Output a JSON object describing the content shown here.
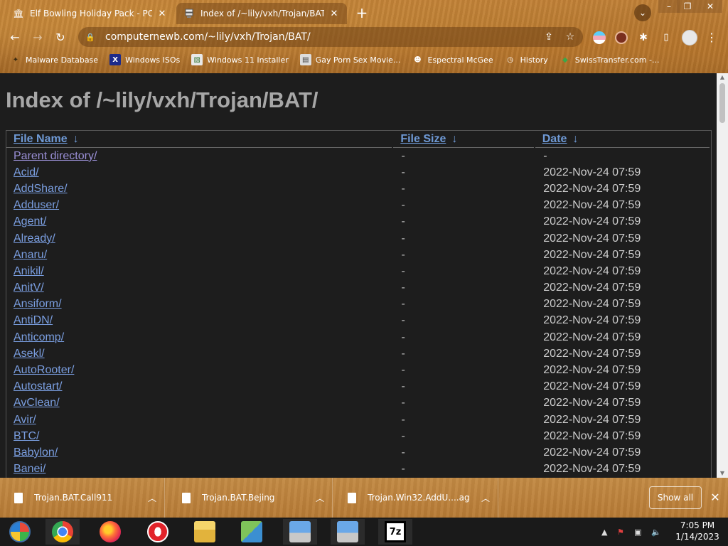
{
  "browser": {
    "tabs": [
      {
        "title": "Elf Bowling Holiday Pack - PC gam",
        "favicon": "building-icon",
        "active": false
      },
      {
        "title": "Index of /~lily/vxh/Trojan/BAT/",
        "favicon": "server-icon",
        "active": true
      }
    ],
    "url": "computernewb.com/~lily/vxh/Trojan/BAT/",
    "bookmarks": [
      {
        "label": "Malware Database",
        "icon": "malware-icon"
      },
      {
        "label": "Windows ISOs",
        "icon": "x-icon"
      },
      {
        "label": "Windows 11 Installer",
        "icon": "image-icon"
      },
      {
        "label": "Gay Porn Sex Movie...",
        "icon": "server-icon"
      },
      {
        "label": "Espectral McGee",
        "icon": "ghost-icon"
      },
      {
        "label": "History",
        "icon": "history-icon"
      },
      {
        "label": "SwissTransfer.com -...",
        "icon": "swiss-icon"
      }
    ]
  },
  "page": {
    "heading": "Index of /~lily/vxh/Trojan/BAT/",
    "columns": {
      "name": "File Name",
      "size": "File Size",
      "date": "Date",
      "sort_arrow": "↓"
    },
    "rows": [
      {
        "name": "Parent directory/",
        "size": "-",
        "date": "-"
      },
      {
        "name": "Acid/",
        "size": "-",
        "date": "2022-Nov-24 07:59"
      },
      {
        "name": "AddShare/",
        "size": "-",
        "date": "2022-Nov-24 07:59"
      },
      {
        "name": "Adduser/",
        "size": "-",
        "date": "2022-Nov-24 07:59"
      },
      {
        "name": "Agent/",
        "size": "-",
        "date": "2022-Nov-24 07:59"
      },
      {
        "name": "Already/",
        "size": "-",
        "date": "2022-Nov-24 07:59"
      },
      {
        "name": "Anaru/",
        "size": "-",
        "date": "2022-Nov-24 07:59"
      },
      {
        "name": "Anikil/",
        "size": "-",
        "date": "2022-Nov-24 07:59"
      },
      {
        "name": "AnitV/",
        "size": "-",
        "date": "2022-Nov-24 07:59"
      },
      {
        "name": "Ansiform/",
        "size": "-",
        "date": "2022-Nov-24 07:59"
      },
      {
        "name": "AntiDN/",
        "size": "-",
        "date": "2022-Nov-24 07:59"
      },
      {
        "name": "Anticomp/",
        "size": "-",
        "date": "2022-Nov-24 07:59"
      },
      {
        "name": "Asekl/",
        "size": "-",
        "date": "2022-Nov-24 07:59"
      },
      {
        "name": "AutoRooter/",
        "size": "-",
        "date": "2022-Nov-24 07:59"
      },
      {
        "name": "Autostart/",
        "size": "-",
        "date": "2022-Nov-24 07:59"
      },
      {
        "name": "AvClean/",
        "size": "-",
        "date": "2022-Nov-24 07:59"
      },
      {
        "name": "Avir/",
        "size": "-",
        "date": "2022-Nov-24 07:59"
      },
      {
        "name": "BTC/",
        "size": "-",
        "date": "2022-Nov-24 07:59"
      },
      {
        "name": "Babylon/",
        "size": "-",
        "date": "2022-Nov-24 07:59"
      },
      {
        "name": "Banei/",
        "size": "-",
        "date": "2022-Nov-24 07:59"
      }
    ]
  },
  "downloads": {
    "items": [
      {
        "name": "Trojan.BAT.Call911"
      },
      {
        "name": "Trojan.BAT.Bejing"
      },
      {
        "name": "Trojan.Win32.AddU....ag"
      }
    ],
    "show_all": "Show all"
  },
  "taskbar": {
    "apps": [
      "start-orb-icon",
      "chrome-icon",
      "firefox-icon",
      "opera-icon",
      "file-explorer-icon",
      "network-icon",
      "installer-icon",
      "installer-icon",
      "7zip-icon"
    ],
    "sevenzip_label": "7z",
    "clock": {
      "time": "7:05 PM",
      "date": "1/14/2023"
    }
  }
}
